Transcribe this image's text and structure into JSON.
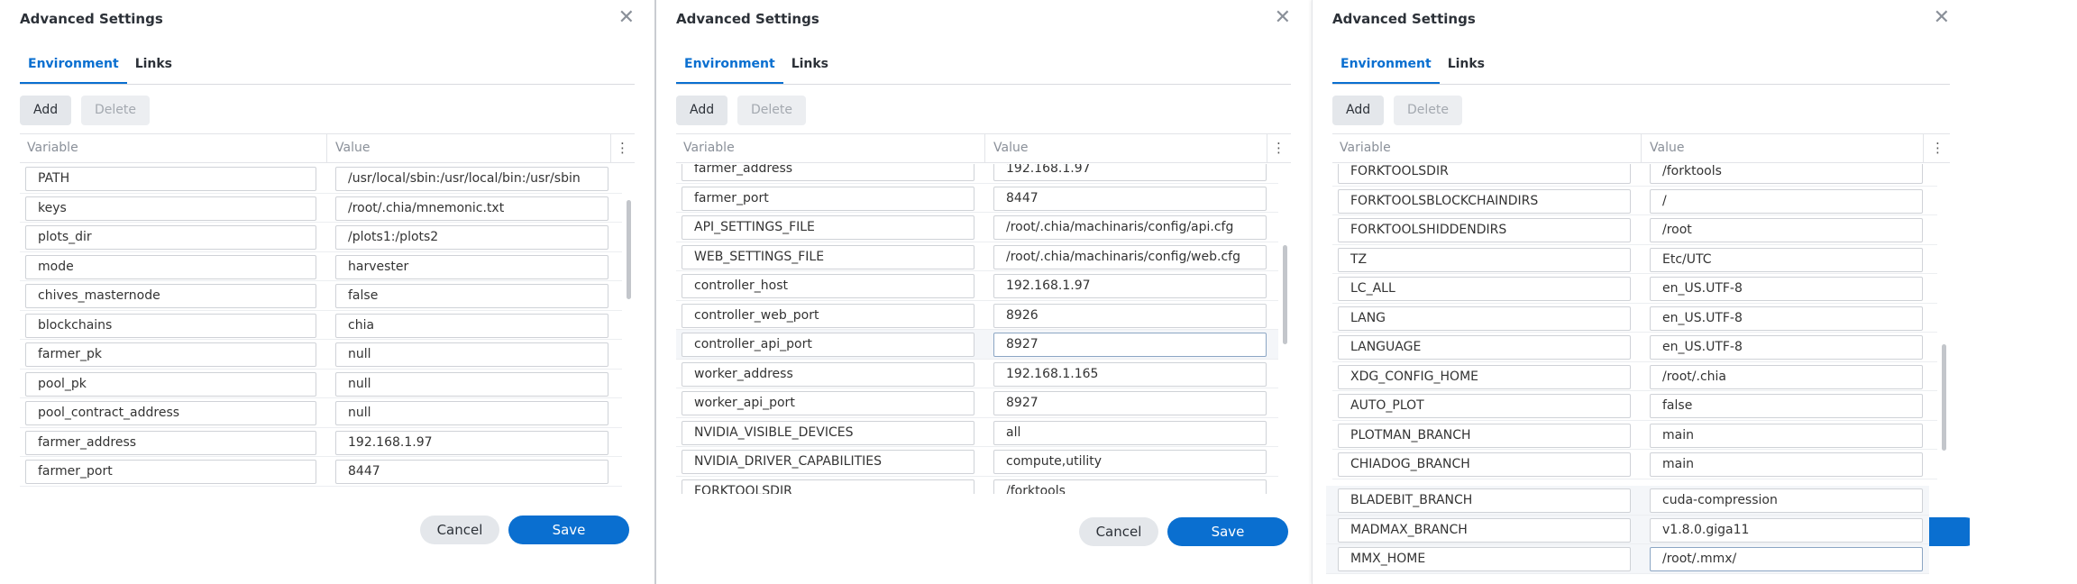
{
  "dialogs": [
    {
      "title": "Advanced Settings",
      "close_glyph": "✕",
      "tabs": [
        "Environment",
        "Links"
      ],
      "active_tab": "Environment",
      "add_label": "Add",
      "delete_label": "Delete",
      "columns": [
        "Variable",
        "Value"
      ],
      "rows": [
        {
          "variable": "PATH",
          "value": "/usr/local/sbin:/usr/local/bin:/usr/sbin"
        },
        {
          "variable": "keys",
          "value": "/root/.chia/mnemonic.txt"
        },
        {
          "variable": "plots_dir",
          "value": "/plots1:/plots2"
        },
        {
          "variable": "mode",
          "value": "harvester"
        },
        {
          "variable": "chives_masternode",
          "value": "false"
        },
        {
          "variable": "blockchains",
          "value": "chia"
        },
        {
          "variable": "farmer_pk",
          "value": "null"
        },
        {
          "variable": "pool_pk",
          "value": "null"
        },
        {
          "variable": "pool_contract_address",
          "value": "null"
        },
        {
          "variable": "farmer_address",
          "value": "192.168.1.97"
        },
        {
          "variable": "farmer_port",
          "value": "8447"
        }
      ],
      "cancel_label": "Cancel",
      "save_label": "Save"
    },
    {
      "title": "Advanced Settings",
      "close_glyph": "✕",
      "tabs": [
        "Environment",
        "Links"
      ],
      "active_tab": "Environment",
      "add_label": "Add",
      "delete_label": "Delete",
      "columns": [
        "Variable",
        "Value"
      ],
      "rows": [
        {
          "variable": "farmer_address",
          "value": "192.168.1.97"
        },
        {
          "variable": "farmer_port",
          "value": "8447"
        },
        {
          "variable": "API_SETTINGS_FILE",
          "value": "/root/.chia/machinaris/config/api.cfg"
        },
        {
          "variable": "WEB_SETTINGS_FILE",
          "value": "/root/.chia/machinaris/config/web.cfg"
        },
        {
          "variable": "controller_host",
          "value": "192.168.1.97"
        },
        {
          "variable": "controller_web_port",
          "value": "8926"
        },
        {
          "variable": "controller_api_port",
          "value": "8927"
        },
        {
          "variable": "worker_address",
          "value": "192.168.1.165"
        },
        {
          "variable": "worker_api_port",
          "value": "8927"
        },
        {
          "variable": "NVIDIA_VISIBLE_DEVICES",
          "value": "all"
        },
        {
          "variable": "NVIDIA_DRIVER_CAPABILITIES",
          "value": "compute,utility"
        },
        {
          "variable": "FORKTOOLSDIR",
          "value": "/forktools"
        }
      ],
      "cancel_label": "Cancel",
      "save_label": "Save"
    },
    {
      "title": "Advanced Settings",
      "close_glyph": "✕",
      "tabs": [
        "Environment",
        "Links"
      ],
      "active_tab": "Environment",
      "add_label": "Add",
      "delete_label": "Delete",
      "columns": [
        "Variable",
        "Value"
      ],
      "rows": [
        {
          "variable": "FORKTOOLSDIR",
          "value": "/forktools"
        },
        {
          "variable": "FORKTOOLSBLOCKCHAINDIRS",
          "value": "/"
        },
        {
          "variable": "FORKTOOLSHIDDENDIRS",
          "value": "/root"
        },
        {
          "variable": "TZ",
          "value": "Etc/UTC"
        },
        {
          "variable": "LC_ALL",
          "value": "en_US.UTF-8"
        },
        {
          "variable": "LANG",
          "value": "en_US.UTF-8"
        },
        {
          "variable": "LANGUAGE",
          "value": "en_US.UTF-8"
        },
        {
          "variable": "XDG_CONFIG_HOME",
          "value": "/root/.chia"
        },
        {
          "variable": "AUTO_PLOT",
          "value": "false"
        },
        {
          "variable": "PLOTMAN_BRANCH",
          "value": "main"
        },
        {
          "variable": "CHIADOG_BRANCH",
          "value": "main"
        }
      ],
      "overflow_rows": [
        {
          "variable": "BLADEBIT_BRANCH",
          "value": "cuda-compression"
        },
        {
          "variable": "MADMAX_BRANCH",
          "value": "v1.8.0.giga11"
        },
        {
          "variable": "MMX_HOME",
          "value": "/root/.mmx/"
        }
      ]
    }
  ],
  "colors": {
    "accent": "#0a6fd0",
    "border": "#cfd2d7",
    "button_gray": "#e4e7eb"
  }
}
